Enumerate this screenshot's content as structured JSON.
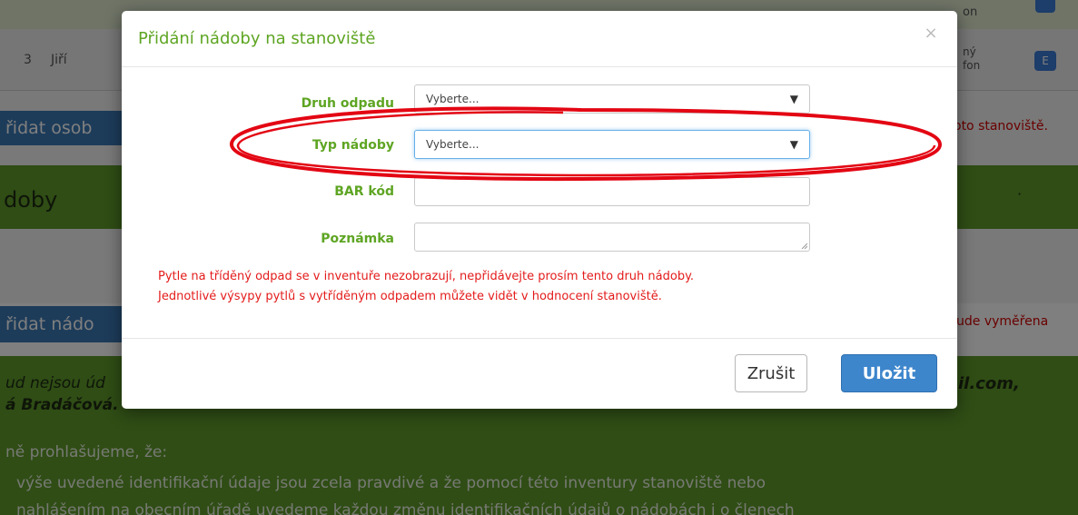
{
  "background": {
    "table_row": {
      "number": "3",
      "name": "Jiří",
      "right_text_top": "on",
      "right_text_lines": [
        "ný",
        "fon"
      ],
      "badge": "E"
    },
    "add_person_button": "řidat osob",
    "red_note_1": "oto stanoviště.",
    "section_title": "doby",
    "dot": "·",
    "add_bin_button": "řidat nádo",
    "red_note_2": "ude vyměřena",
    "line1": "ud nejsou úd",
    "line1_right": "il.com,",
    "line2": "á Bradáčová.",
    "line3": "ně prohlašujeme, že:",
    "line4": "výše uvedené identifikační údaje jsou zcela pravdivé a že pomocí této inventury stanoviště nebo",
    "line5": "nahlášením na obecním úřadě uvedeme každou změnu identifikačních údajů o nádobách i o členech"
  },
  "modal": {
    "title": "Přidání nádoby na stanoviště",
    "close_symbol": "×",
    "fields": {
      "waste_type": {
        "label": "Druh odpadu",
        "value": "Vyberte..."
      },
      "bin_type": {
        "label": "Typ nádoby",
        "value": "Vyberte..."
      },
      "barcode": {
        "label": "BAR kód",
        "value": ""
      },
      "note": {
        "label": "Poznámka",
        "value": ""
      }
    },
    "caret_symbol": "▼",
    "warning_lines": [
      "Pytle na tříděný odpad se v inventuře nezobrazují, nepřidávejte prosím tento druh nádoby.",
      "Jednotlivé výsypy pytlů s vytříděným odpadem můžete vidět v hodnocení stanoviště."
    ],
    "cancel_label": "Zrušit",
    "save_label": "Uložit"
  },
  "colors": {
    "accent_green": "#5ea523",
    "background_green": "#5e9a2a",
    "primary_blue": "#3d86cc",
    "warning_red": "#e41b1b",
    "annotation_red": "#e30613"
  }
}
